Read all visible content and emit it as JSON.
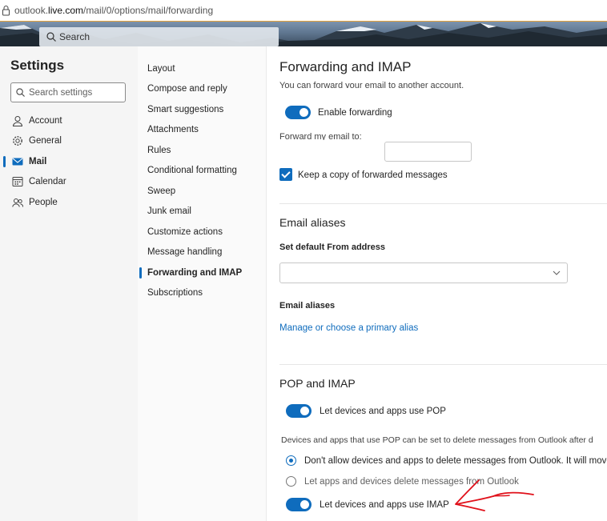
{
  "browser": {
    "url_prefix": "outlook.",
    "url_domain": "live.com",
    "url_path": "/mail/0/options/mail/forwarding"
  },
  "header": {
    "search_label": "Search"
  },
  "settings": {
    "title": "Settings",
    "search_placeholder": "Search settings",
    "categories": [
      {
        "label": "Account",
        "icon": "person-icon"
      },
      {
        "label": "General",
        "icon": "gear-icon"
      },
      {
        "label": "Mail",
        "icon": "mail-icon",
        "active": true
      },
      {
        "label": "Calendar",
        "icon": "calendar-icon"
      },
      {
        "label": "People",
        "icon": "people-icon"
      }
    ]
  },
  "mail_nav": {
    "items": [
      "Layout",
      "Compose and reply",
      "Smart suggestions",
      "Attachments",
      "Rules",
      "Conditional formatting",
      "Sweep",
      "Junk email",
      "Customize actions",
      "Message handling",
      "Forwarding and IMAP",
      "Subscriptions"
    ],
    "active": "Forwarding and IMAP"
  },
  "main": {
    "title": "Forwarding and IMAP",
    "forwarding": {
      "clipped_intro": "You can forward your email to another account.",
      "enable_label": "Enable forwarding",
      "forward_to_label": "Forward my email to:",
      "forward_to_value": "",
      "keep_copy_label": "Keep a copy of forwarded messages"
    },
    "aliases": {
      "title": "Email aliases",
      "default_from_label": "Set default From address",
      "default_from_value": "",
      "aliases_label": "Email aliases",
      "manage_link": "Manage or choose a primary alias"
    },
    "pop_imap": {
      "title": "POP and IMAP",
      "pop_toggle_label": "Let devices and apps use POP",
      "pop_description": "Devices and apps that use POP can be set to delete messages from Outlook after d",
      "radio_dont_allow": "Don't allow devices and apps to delete messages from Outlook. It will move t",
      "radio_allow": "Let apps and devices delete messages from Outlook",
      "imap_toggle_label": "Let devices and apps use IMAP"
    }
  },
  "colors": {
    "accent": "#0f6cbd",
    "annotation": "#e0101a"
  }
}
